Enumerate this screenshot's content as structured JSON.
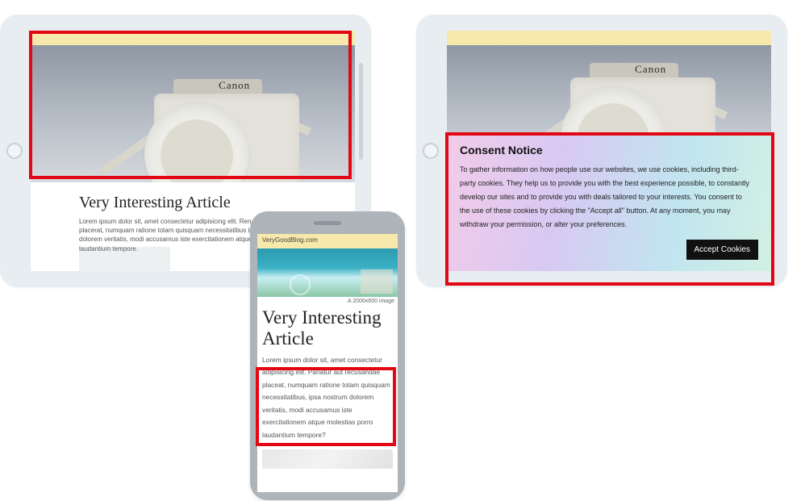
{
  "tablet_left": {
    "hero_label": "Canon",
    "article_title": "Very Interesting Article",
    "article_body": "Lorem ipsum dolor sit, amet consectetur adipisicing elit. Rerum aut malesuada placerat, numquam ratione totam quisquam necessitatibus ipsa nostrum dolorem veritatis, modi accusamus iste exercitationem atque molestias porro laudantium tempore."
  },
  "tablet_right": {
    "hero_label": "Canon",
    "consent_title": "Consent Notice",
    "consent_body": "To gather information on how people use our websites, we use cookies, including third-party cookies. They help us to provide you with the best experience possible, to constantly develop our sites and to provide you with deals tailored to your interests. You consent to the use of these cookies by clicking the \"Accept all\" button. At any moment, you may withdraw your permission, or alter your preferences.",
    "accept_label": "Accept Cookies"
  },
  "phone": {
    "url_bar": "VeryGoodBlog.com",
    "image_caption": "A 2000x600 image",
    "article_title": "Very Interesting Article",
    "article_body": "Lorem ipsum dolor sit, amet consectetur adipisicing elit. Pariatur aut recusandae placeat, numquam ratione totam quisquam necessitatibus, ipsa nostrum dolorem veritatis, modi accusamus iste exercitationem atque molestias porro laudantium tempore?"
  }
}
